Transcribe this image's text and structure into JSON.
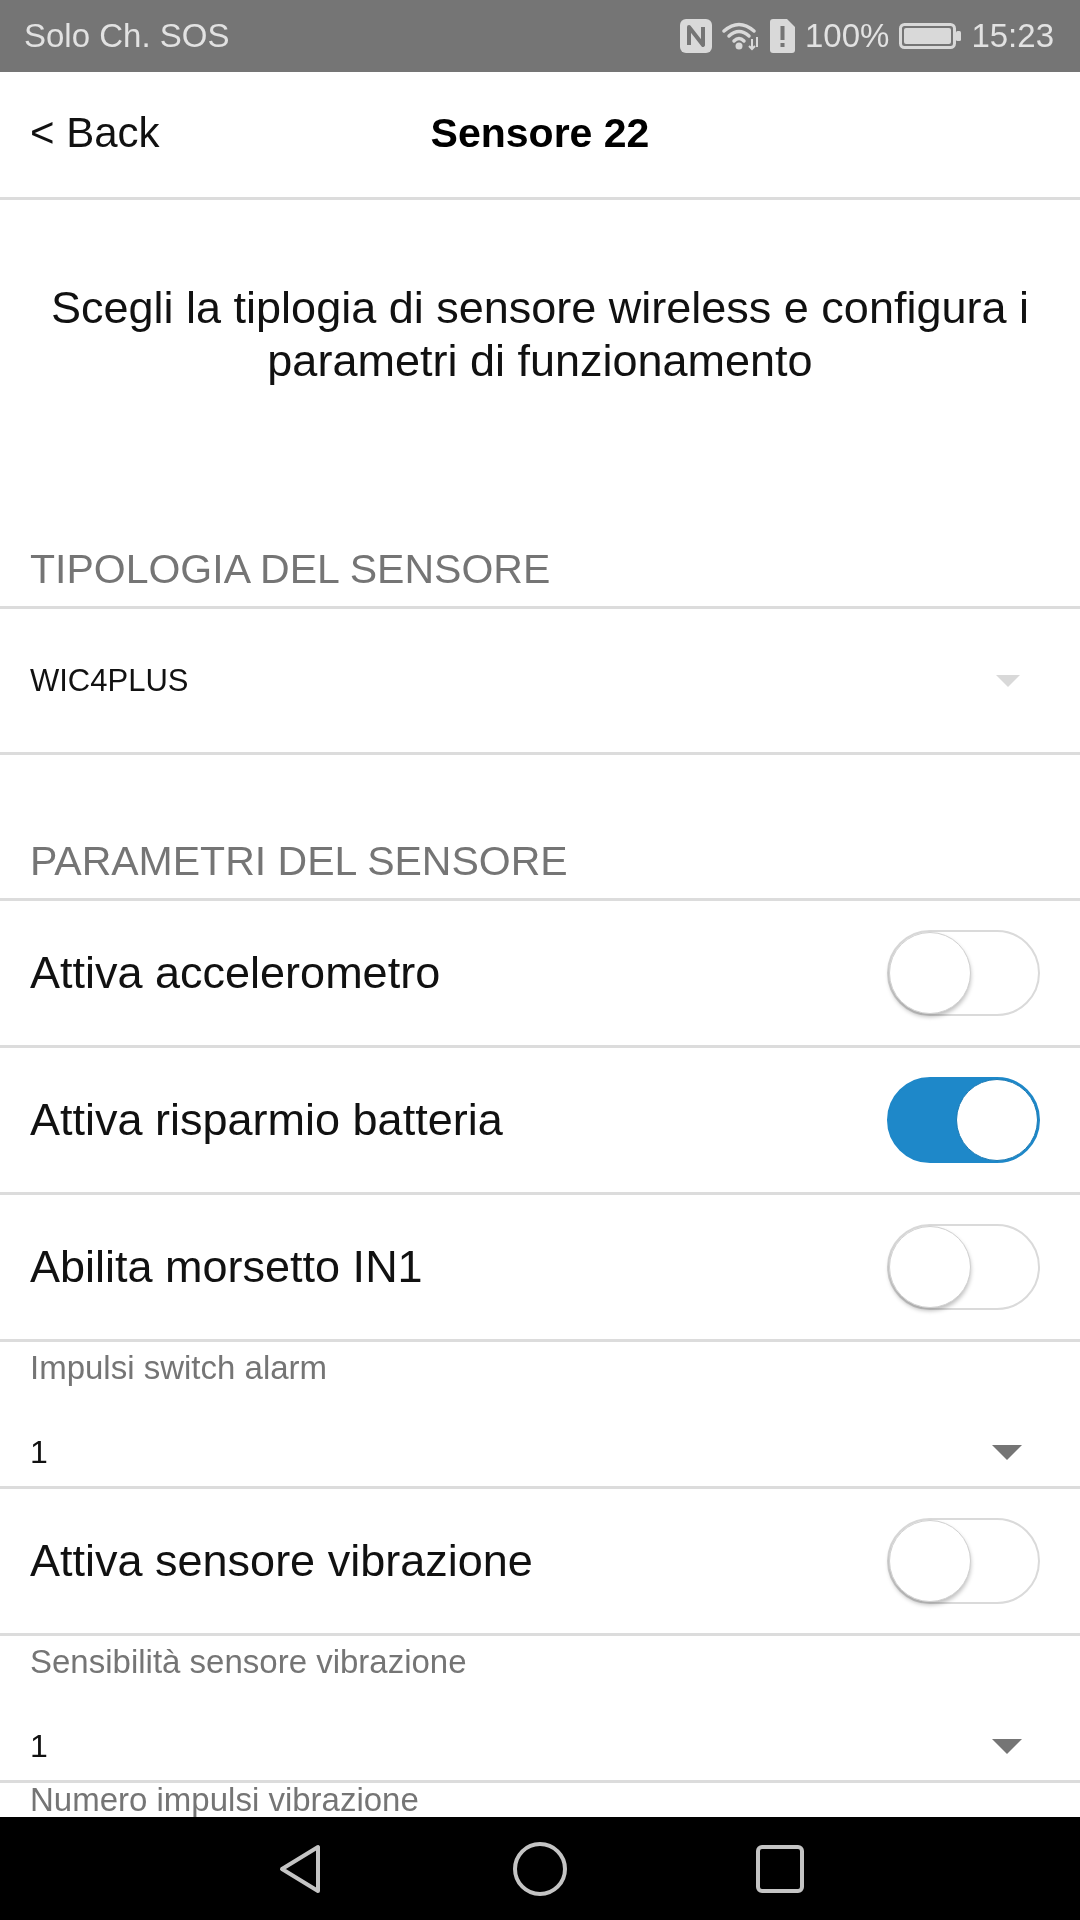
{
  "status_bar": {
    "carrier": "Solo Ch. SOS",
    "battery": "100%",
    "time": "15:23"
  },
  "header": {
    "back": "< Back",
    "title": "Sensore 22"
  },
  "intro": "Scegli la tiplogia di sensore wireless e configura i parametri di funzionamento",
  "sections": [
    {
      "title": "TIPOLOGIA DEL SENSORE",
      "rows": [
        {
          "kind": "select",
          "value": "WIC4PLUS",
          "disabled": true
        }
      ]
    },
    {
      "title": "PARAMETRI DEL SENSORE",
      "rows": [
        {
          "kind": "toggle",
          "label": "Attiva accelerometro",
          "on": false
        },
        {
          "kind": "toggle",
          "label": "Attiva risparmio batteria",
          "on": true
        },
        {
          "kind": "toggle",
          "label": "Abilita morsetto IN1",
          "on": false
        },
        {
          "kind": "picker",
          "label": "Impulsi switch alarm",
          "value": "1",
          "disabled": false
        },
        {
          "kind": "toggle",
          "label": "Attiva sensore vibrazione",
          "on": false
        },
        {
          "kind": "picker",
          "label": "Sensibilità sensore vibrazione",
          "value": "1",
          "disabled": false
        },
        {
          "kind": "picker",
          "label": "Numero impulsi vibrazione"
        }
      ]
    }
  ]
}
